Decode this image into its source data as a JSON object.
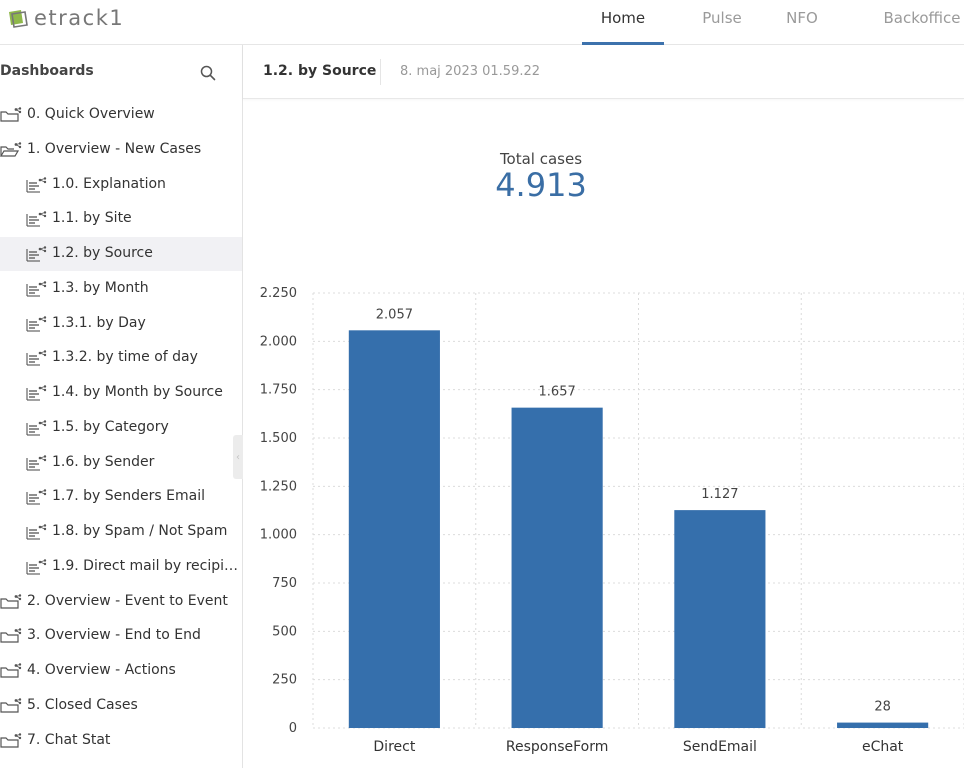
{
  "app": {
    "logo_text": "etrack1"
  },
  "nav": {
    "items": [
      {
        "label": "Home",
        "active": true
      },
      {
        "label": "Pulse",
        "active": false
      },
      {
        "label": "NFO",
        "active": false
      },
      {
        "label": "Backoffice",
        "active": false
      }
    ],
    "accent_color": "#3d72ad"
  },
  "sidebar": {
    "title": "Dashboards",
    "search_icon": "search-icon",
    "items": [
      {
        "label": "0. Quick Overview",
        "icon": "folder-share-icon",
        "level": 0,
        "selected": false
      },
      {
        "label": "1. Overview - New Cases",
        "icon": "folder-open-share-icon",
        "level": 0,
        "selected": false
      },
      {
        "label": "1.0. Explanation",
        "icon": "dashboard-share-icon",
        "level": 1,
        "selected": false
      },
      {
        "label": "1.1. by Site",
        "icon": "dashboard-share-icon",
        "level": 1,
        "selected": false
      },
      {
        "label": "1.2. by Source",
        "icon": "dashboard-share-icon",
        "level": 1,
        "selected": true
      },
      {
        "label": "1.3. by Month",
        "icon": "dashboard-share-icon",
        "level": 1,
        "selected": false
      },
      {
        "label": "1.3.1. by Day",
        "icon": "dashboard-share-icon",
        "level": 1,
        "selected": false
      },
      {
        "label": "1.3.2. by time of day",
        "icon": "dashboard-share-icon",
        "level": 1,
        "selected": false
      },
      {
        "label": "1.4. by Month by Source",
        "icon": "dashboard-share-icon",
        "level": 1,
        "selected": false
      },
      {
        "label": "1.5. by Category",
        "icon": "dashboard-share-icon",
        "level": 1,
        "selected": false
      },
      {
        "label": "1.6. by Sender",
        "icon": "dashboard-share-icon",
        "level": 1,
        "selected": false
      },
      {
        "label": "1.7. by Senders Email",
        "icon": "dashboard-share-icon",
        "level": 1,
        "selected": false
      },
      {
        "label": "1.8. by Spam / Not Spam",
        "icon": "dashboard-share-icon",
        "level": 1,
        "selected": false
      },
      {
        "label": "1.9. Direct mail by recipie…",
        "icon": "dashboard-share-icon",
        "level": 1,
        "selected": false
      },
      {
        "label": "2. Overview - Event to Event",
        "icon": "folder-share-icon",
        "level": 0,
        "selected": false
      },
      {
        "label": "3. Overview - End to End",
        "icon": "folder-share-icon",
        "level": 0,
        "selected": false
      },
      {
        "label": "4. Overview - Actions",
        "icon": "folder-share-icon",
        "level": 0,
        "selected": false
      },
      {
        "label": "5. Closed Cases",
        "icon": "folder-share-icon",
        "level": 0,
        "selected": false
      },
      {
        "label": "7. Chat Stat",
        "icon": "folder-share-icon",
        "level": 0,
        "selected": false
      }
    ],
    "collapse_icon": "chevron-left-icon"
  },
  "main": {
    "title": "1.2. by Source",
    "timestamp": "8. maj 2023 01.59.22",
    "kpi": {
      "label": "Total cases",
      "value": "4.913"
    }
  },
  "chart_data": {
    "type": "bar",
    "categories": [
      "Direct",
      "ResponseForm",
      "SendEmail",
      "eChat"
    ],
    "values": [
      2057,
      1657,
      1127,
      28
    ],
    "value_labels": [
      "2.057",
      "1.657",
      "1.127",
      "28"
    ],
    "ylim": [
      0,
      2250
    ],
    "y_ticks": [
      0,
      250,
      500,
      750,
      1000,
      1250,
      1500,
      1750,
      2000,
      2250
    ],
    "y_tick_labels": [
      "0",
      "250",
      "500",
      "750",
      "1.000",
      "1.250",
      "1.500",
      "1.750",
      "2.000",
      "2.250"
    ],
    "grid": true,
    "bar_color": "#356fac"
  }
}
